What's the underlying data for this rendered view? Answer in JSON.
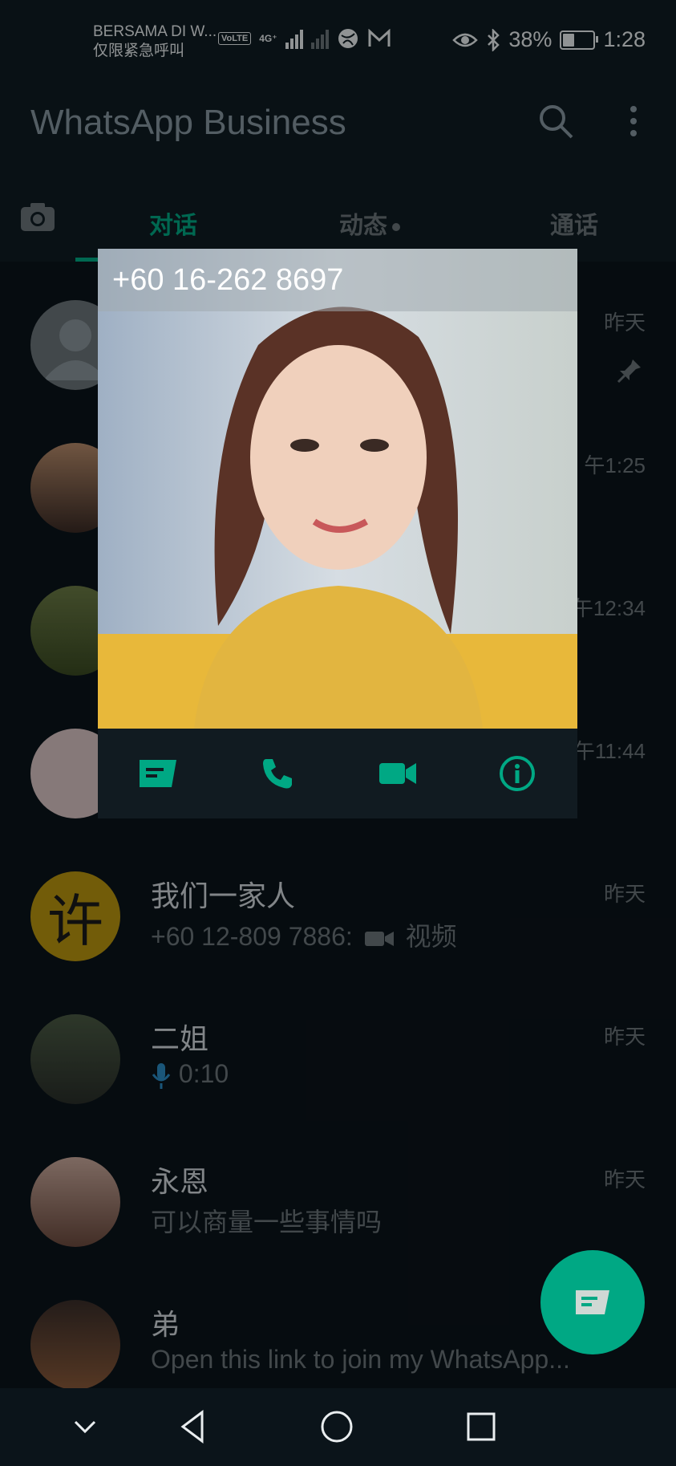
{
  "status": {
    "carrier_line1": "BERSAMA DI W...",
    "carrier_line2": "仅限紧急呼叫",
    "volte": "VoLTE",
    "network": "4G⁺",
    "battery": "38%",
    "time": "1:28"
  },
  "app": {
    "title": "WhatsApp Business",
    "tabs": [
      "对话",
      "动态",
      "通话"
    ]
  },
  "popup": {
    "number": "+60 16-262 8697",
    "actions": [
      "message-icon",
      "call-icon",
      "video-icon",
      "info-icon"
    ]
  },
  "chats": [
    {
      "name": "",
      "msg": "",
      "time": "昨天"
    },
    {
      "name": "",
      "msg": "",
      "time": "午1:25"
    },
    {
      "name": "",
      "msg": "",
      "time": "午12:34"
    },
    {
      "name": "",
      "msg": "",
      "time": "午11:44"
    },
    {
      "name": "我们一家人",
      "msg_prefix": "+60 12-809 7886:",
      "msg": "视频",
      "time": "昨天",
      "avatar_char": "许"
    },
    {
      "name": "二姐",
      "msg": "0:10",
      "time": "昨天"
    },
    {
      "name": "永恩",
      "msg": "可以商量一些事情吗",
      "time": "昨天"
    },
    {
      "name": "弟",
      "msg": "Open this link to join my WhatsApp...",
      "time": ""
    }
  ],
  "colors": {
    "accent": "#00a884",
    "background": "#0b141a",
    "bar": "#0f1c22"
  }
}
